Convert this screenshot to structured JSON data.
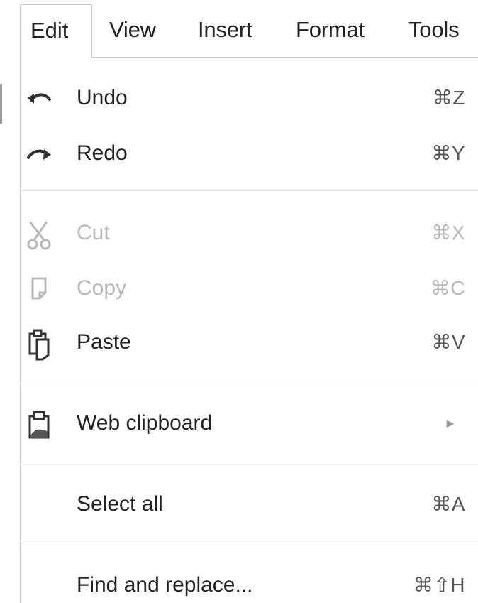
{
  "menubar": {
    "items": [
      {
        "label": "Edit"
      },
      {
        "label": "View"
      },
      {
        "label": "Insert"
      },
      {
        "label": "Format"
      },
      {
        "label": "Tools"
      }
    ]
  },
  "dropdown": {
    "items": [
      {
        "label": "Undo",
        "shortcut": "⌘Z",
        "icon": "undo-icon",
        "enabled": true
      },
      {
        "label": "Redo",
        "shortcut": "⌘Y",
        "icon": "redo-icon",
        "enabled": true
      },
      {
        "label": "Cut",
        "shortcut": "⌘X",
        "icon": "scissors-icon",
        "enabled": false
      },
      {
        "label": "Copy",
        "shortcut": "⌘C",
        "icon": "copy-icon",
        "enabled": false
      },
      {
        "label": "Paste",
        "shortcut": "⌘V",
        "icon": "paste-icon",
        "enabled": true
      },
      {
        "label": "Web clipboard",
        "submenu_indicator": "►",
        "icon": "web-clipboard-icon",
        "enabled": true
      },
      {
        "label": "Select all",
        "shortcut": "⌘A",
        "enabled": true
      },
      {
        "label": "Find and replace...",
        "shortcut": "⌘⇧H",
        "enabled": true
      }
    ]
  },
  "colors": {
    "text": "#222222",
    "disabled_text": "#b8b8b8",
    "border": "#c8c8c8",
    "separator": "#e3e3e3"
  }
}
